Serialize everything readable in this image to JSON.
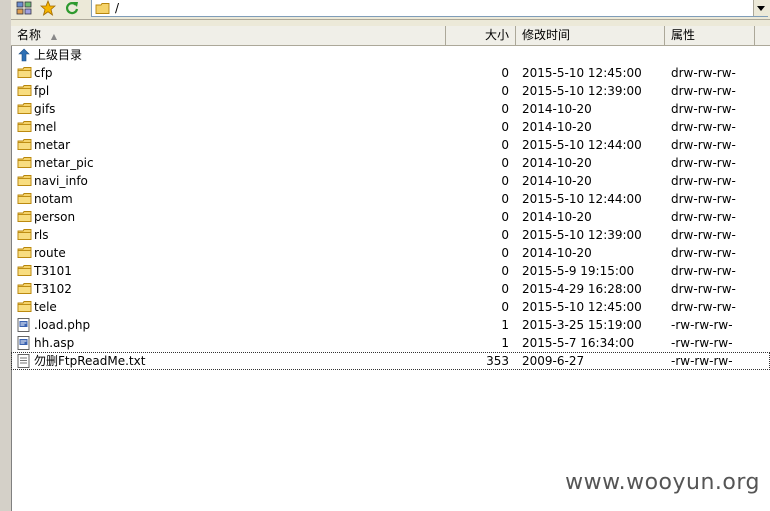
{
  "toolbar": {
    "icons": [
      "sitemap-icon",
      "star-icon",
      "refresh-icon"
    ],
    "address": "/"
  },
  "columns": {
    "name": "名称",
    "size": "大小",
    "modified": "修改时间",
    "attr": "属性"
  },
  "parent_dir_label": "上级目录",
  "files": [
    {
      "name": "cfp",
      "size": "0",
      "date": "2015-5-10 12:45:00",
      "attr": "drw-rw-rw-",
      "type": "folder"
    },
    {
      "name": "fpl",
      "size": "0",
      "date": "2015-5-10 12:39:00",
      "attr": "drw-rw-rw-",
      "type": "folder"
    },
    {
      "name": "gifs",
      "size": "0",
      "date": "2014-10-20",
      "attr": "drw-rw-rw-",
      "type": "folder"
    },
    {
      "name": "mel",
      "size": "0",
      "date": "2014-10-20",
      "attr": "drw-rw-rw-",
      "type": "folder"
    },
    {
      "name": "metar",
      "size": "0",
      "date": "2015-5-10 12:44:00",
      "attr": "drw-rw-rw-",
      "type": "folder"
    },
    {
      "name": "metar_pic",
      "size": "0",
      "date": "2014-10-20",
      "attr": "drw-rw-rw-",
      "type": "folder"
    },
    {
      "name": "navi_info",
      "size": "0",
      "date": "2014-10-20",
      "attr": "drw-rw-rw-",
      "type": "folder"
    },
    {
      "name": "notam",
      "size": "0",
      "date": "2015-5-10 12:44:00",
      "attr": "drw-rw-rw-",
      "type": "folder"
    },
    {
      "name": "person",
      "size": "0",
      "date": "2014-10-20",
      "attr": "drw-rw-rw-",
      "type": "folder"
    },
    {
      "name": "rls",
      "size": "0",
      "date": "2015-5-10 12:39:00",
      "attr": "drw-rw-rw-",
      "type": "folder"
    },
    {
      "name": "route",
      "size": "0",
      "date": "2014-10-20",
      "attr": "drw-rw-rw-",
      "type": "folder"
    },
    {
      "name": "T3101",
      "size": "0",
      "date": "2015-5-9 19:15:00",
      "attr": "drw-rw-rw-",
      "type": "folder"
    },
    {
      "name": "T3102",
      "size": "0",
      "date": "2015-4-29 16:28:00",
      "attr": "drw-rw-rw-",
      "type": "folder"
    },
    {
      "name": "tele",
      "size": "0",
      "date": "2015-5-10 12:45:00",
      "attr": "drw-rw-rw-",
      "type": "folder"
    },
    {
      "name": ".load.php",
      "size": "1",
      "date": "2015-3-25 15:19:00",
      "attr": "-rw-rw-rw-",
      "type": "script"
    },
    {
      "name": "hh.asp",
      "size": "1",
      "date": "2015-5-7 16:34:00",
      "attr": "-rw-rw-rw-",
      "type": "script"
    },
    {
      "name": "勿删FtpReadMe.txt",
      "size": "353",
      "date": "2009-6-27",
      "attr": "-rw-rw-rw-",
      "type": "text",
      "selected": true
    }
  ],
  "watermark": "www.wooyun.org",
  "colors": {
    "folder_fill": "#f5d36b",
    "folder_stroke": "#b8860b",
    "up_arrow": "#2d6fb5"
  }
}
